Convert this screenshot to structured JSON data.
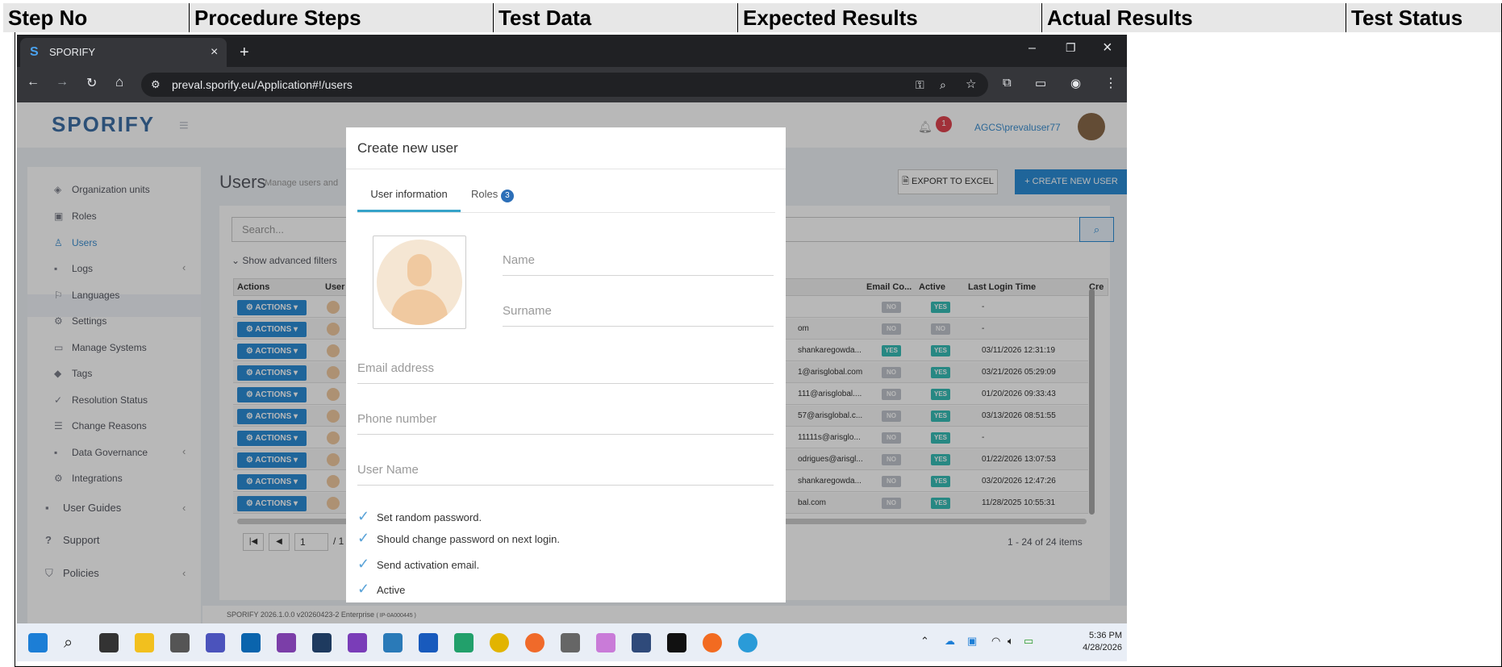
{
  "table_header": {
    "col1": "Step No",
    "col2": "Procedure Steps",
    "col3": "Test Data",
    "col4": "Expected Results",
    "col5": "Actual Results",
    "col6": "Test Status"
  },
  "browser": {
    "tab_title": "SPORIFY",
    "url": "preval.sporify.eu/Application#!/users"
  },
  "app": {
    "logo": "SPORIFY",
    "notification_count": "1",
    "user": "AGCS\\prevaluser77",
    "page_title": "Users",
    "page_subtitle": "Manage users and",
    "export_button": "EXPORT TO EXCEL",
    "create_button": "+ CREATE NEW USER",
    "search_placeholder": "Search...",
    "advanced_filters": "Show advanced filters",
    "footer": "SPORIFY 2026.1.0.0 v20260423-2 Enterprise",
    "footer_small": "( IP-0A000445 )",
    "pagination_page": "1",
    "pagination_sep": "/ 1",
    "items_count": "1 - 24 of 24 items"
  },
  "sidebar": {
    "items": [
      {
        "label": "Organization units",
        "icon": "layers-icon"
      },
      {
        "label": "Roles",
        "icon": "briefcase-icon"
      },
      {
        "label": "Users",
        "icon": "users-icon"
      },
      {
        "label": "Logs",
        "icon": "book-icon"
      },
      {
        "label": "Languages",
        "icon": "flag-icon"
      },
      {
        "label": "Settings",
        "icon": "gear-icon"
      },
      {
        "label": "Manage Systems",
        "icon": "laptop-icon"
      },
      {
        "label": "Tags",
        "icon": "tags-icon"
      },
      {
        "label": "Resolution Status",
        "icon": "check-icon"
      },
      {
        "label": "Change Reasons",
        "icon": "list-icon"
      },
      {
        "label": "Data Governance",
        "icon": "book-icon"
      },
      {
        "label": "Integrations",
        "icon": "cogs-icon"
      },
      {
        "label": "User Guides",
        "icon": "book-icon"
      },
      {
        "label": "Support",
        "icon": "question-icon"
      },
      {
        "label": "Policies",
        "icon": "shield-icon"
      }
    ]
  },
  "grid": {
    "headers": {
      "actions": "Actions",
      "user": "User",
      "email_confirmed": "Email Co...",
      "active": "Active",
      "last_login": "Last Login Time",
      "created": "Cre"
    },
    "action_label": "ACTIONS",
    "rows": [
      {
        "email": "",
        "email_confirmed": "NO",
        "active": "YES",
        "last_login": "-"
      },
      {
        "email": "om",
        "email_confirmed": "NO",
        "active": "NO",
        "last_login": "-"
      },
      {
        "email": "shankaregowda...",
        "email_confirmed": "YES",
        "active": "YES",
        "last_login": "03/11/2026 12:31:19"
      },
      {
        "email": "1@arisglobal.com",
        "email_confirmed": "NO",
        "active": "YES",
        "last_login": "03/21/2026 05:29:09"
      },
      {
        "email": "111@arisglobal....",
        "email_confirmed": "NO",
        "active": "YES",
        "last_login": "01/20/2026 09:33:43"
      },
      {
        "email": "57@arisglobal.c...",
        "email_confirmed": "NO",
        "active": "YES",
        "last_login": "03/13/2026 08:51:55"
      },
      {
        "email": "11111s@arisglo...",
        "email_confirmed": "NO",
        "active": "YES",
        "last_login": "-"
      },
      {
        "email": "odrigues@arisgl...",
        "email_confirmed": "NO",
        "active": "YES",
        "last_login": "01/22/2026 13:07:53"
      },
      {
        "email": "shankaregowda...",
        "email_confirmed": "NO",
        "active": "YES",
        "last_login": "03/20/2026 12:47:26"
      },
      {
        "email": "bal.com",
        "email_confirmed": "NO",
        "active": "YES",
        "last_login": "11/28/2025 10:55:31"
      }
    ]
  },
  "modal": {
    "title": "Create new user",
    "tab_info": "User information",
    "tab_roles": "Roles",
    "roles_count": "3",
    "name_placeholder": "Name",
    "surname_placeholder": "Surname",
    "email_placeholder": "Email address",
    "phone_placeholder": "Phone number",
    "username_placeholder": "User Name",
    "checks": [
      "Set random password.",
      "Should change password on next login.",
      "Send activation email.",
      "Active"
    ]
  },
  "taskbar": {
    "time": "5:36 PM",
    "date": "4/28/2026"
  },
  "colors": {
    "accent": "#2c8dd6",
    "yes_badge": "#37bdb6",
    "no_badge": "#bfc4cc",
    "notification": "#e0454f"
  }
}
